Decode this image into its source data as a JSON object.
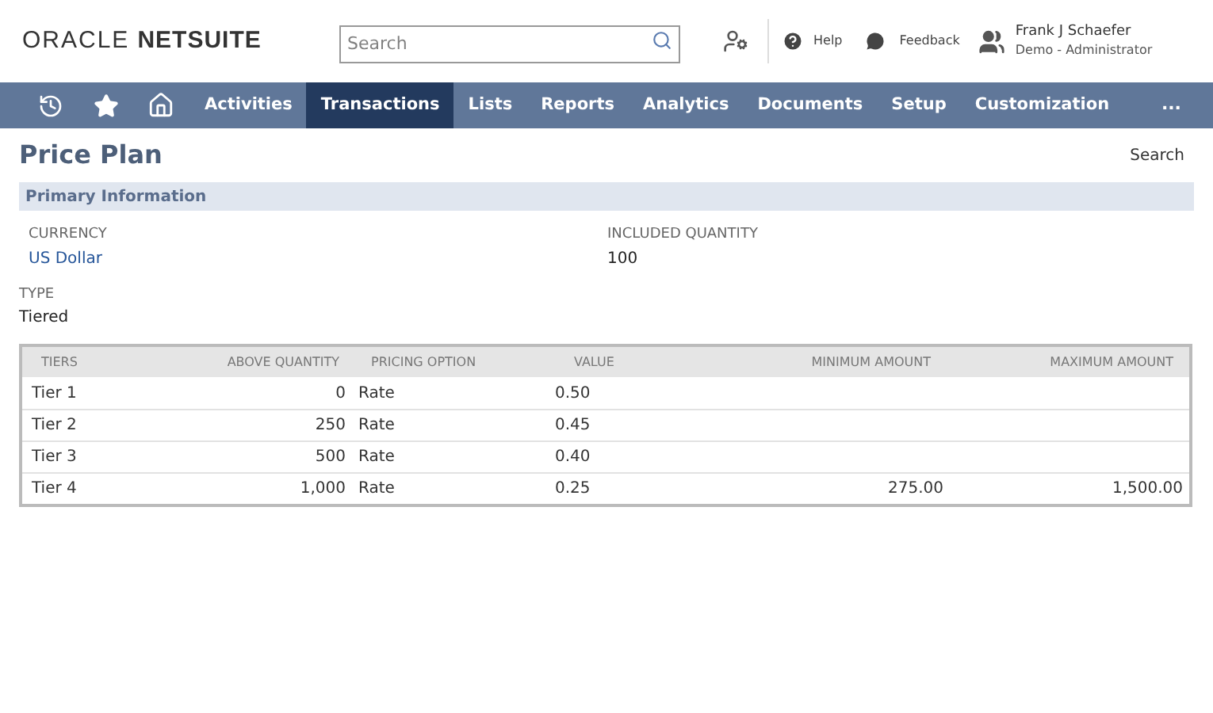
{
  "header": {
    "logo_left": "ORACLE",
    "logo_right": "NETSUITE",
    "search": {
      "placeholder": "Search"
    },
    "help": "Help",
    "feedback": "Feedback",
    "user": {
      "name": "Frank J Schaefer",
      "role": "Demo - Administrator"
    }
  },
  "nav": {
    "items": [
      {
        "label": "Activities",
        "selected": false
      },
      {
        "label": "Transactions",
        "selected": true
      },
      {
        "label": "Lists",
        "selected": false
      },
      {
        "label": "Reports",
        "selected": false
      },
      {
        "label": "Analytics",
        "selected": false
      },
      {
        "label": "Documents",
        "selected": false
      },
      {
        "label": "Setup",
        "selected": false
      },
      {
        "label": "Customization",
        "selected": false
      }
    ],
    "more": "..."
  },
  "page": {
    "title": "Price Plan",
    "search_link": "Search",
    "section": "Primary Information",
    "fields": [
      {
        "label": "CURRENCY",
        "value": "US Dollar",
        "kind": "link"
      },
      {
        "label": "INCLUDED QUANTITY",
        "value": "100",
        "kind": "text"
      },
      {
        "label": "TYPE",
        "value": "Tiered",
        "kind": "text"
      }
    ]
  },
  "table": {
    "columns": [
      "TIERS",
      "ABOVE QUANTITY",
      "PRICING OPTION",
      "VALUE",
      "MINIMUM AMOUNT",
      "MAXIMUM AMOUNT"
    ],
    "rows": [
      [
        "Tier 1",
        "0",
        "Rate",
        "0.50",
        "",
        ""
      ],
      [
        "Tier 2",
        "250",
        "Rate",
        "0.45",
        "",
        ""
      ],
      [
        "Tier 3",
        "500",
        "Rate",
        "0.40",
        "",
        ""
      ],
      [
        "Tier 4",
        "1,000",
        "Rate",
        "0.25",
        "275.00",
        "1,500.00"
      ]
    ]
  }
}
